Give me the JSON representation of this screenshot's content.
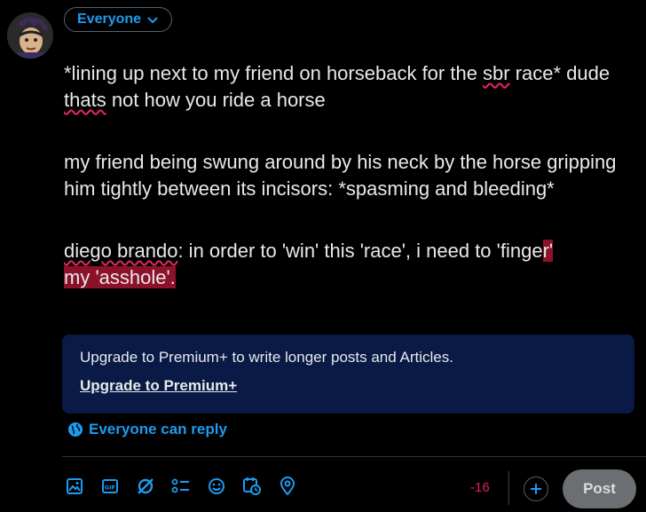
{
  "audience": {
    "label": "Everyone"
  },
  "compose": {
    "p1_a": "*lining up next to my friend on horseback for the ",
    "p1_sbr": "sbr",
    "p1_b": " race* dude ",
    "p1_thats": "thats",
    "p1_c": " not how you ride a horse",
    "p2": "my friend being swung around by his neck by the horse gripping him tightly between its incisors: *spasming and bleeding*",
    "p3_diego": "diego brando",
    "p3_a": ": in order to 'win' this 'race', i need to 'finge",
    "p3_over1": "r'",
    "p3_over2": "my 'asshole'."
  },
  "upsell": {
    "text": "Upgrade to Premium+ to write longer posts and Articles.",
    "link": "Upgrade to Premium+"
  },
  "reply_setting": {
    "label": "Everyone can reply"
  },
  "toolbar": {
    "icons": [
      "image-icon",
      "gif-icon",
      "grok-icon",
      "poll-icon",
      "emoji-icon",
      "schedule-icon",
      "location-icon"
    ]
  },
  "counter": "-16",
  "post_label": "Post",
  "colors": {
    "accent": "#1d9bf0",
    "error": "#e0245e",
    "upsell_bg": "#081a45"
  }
}
